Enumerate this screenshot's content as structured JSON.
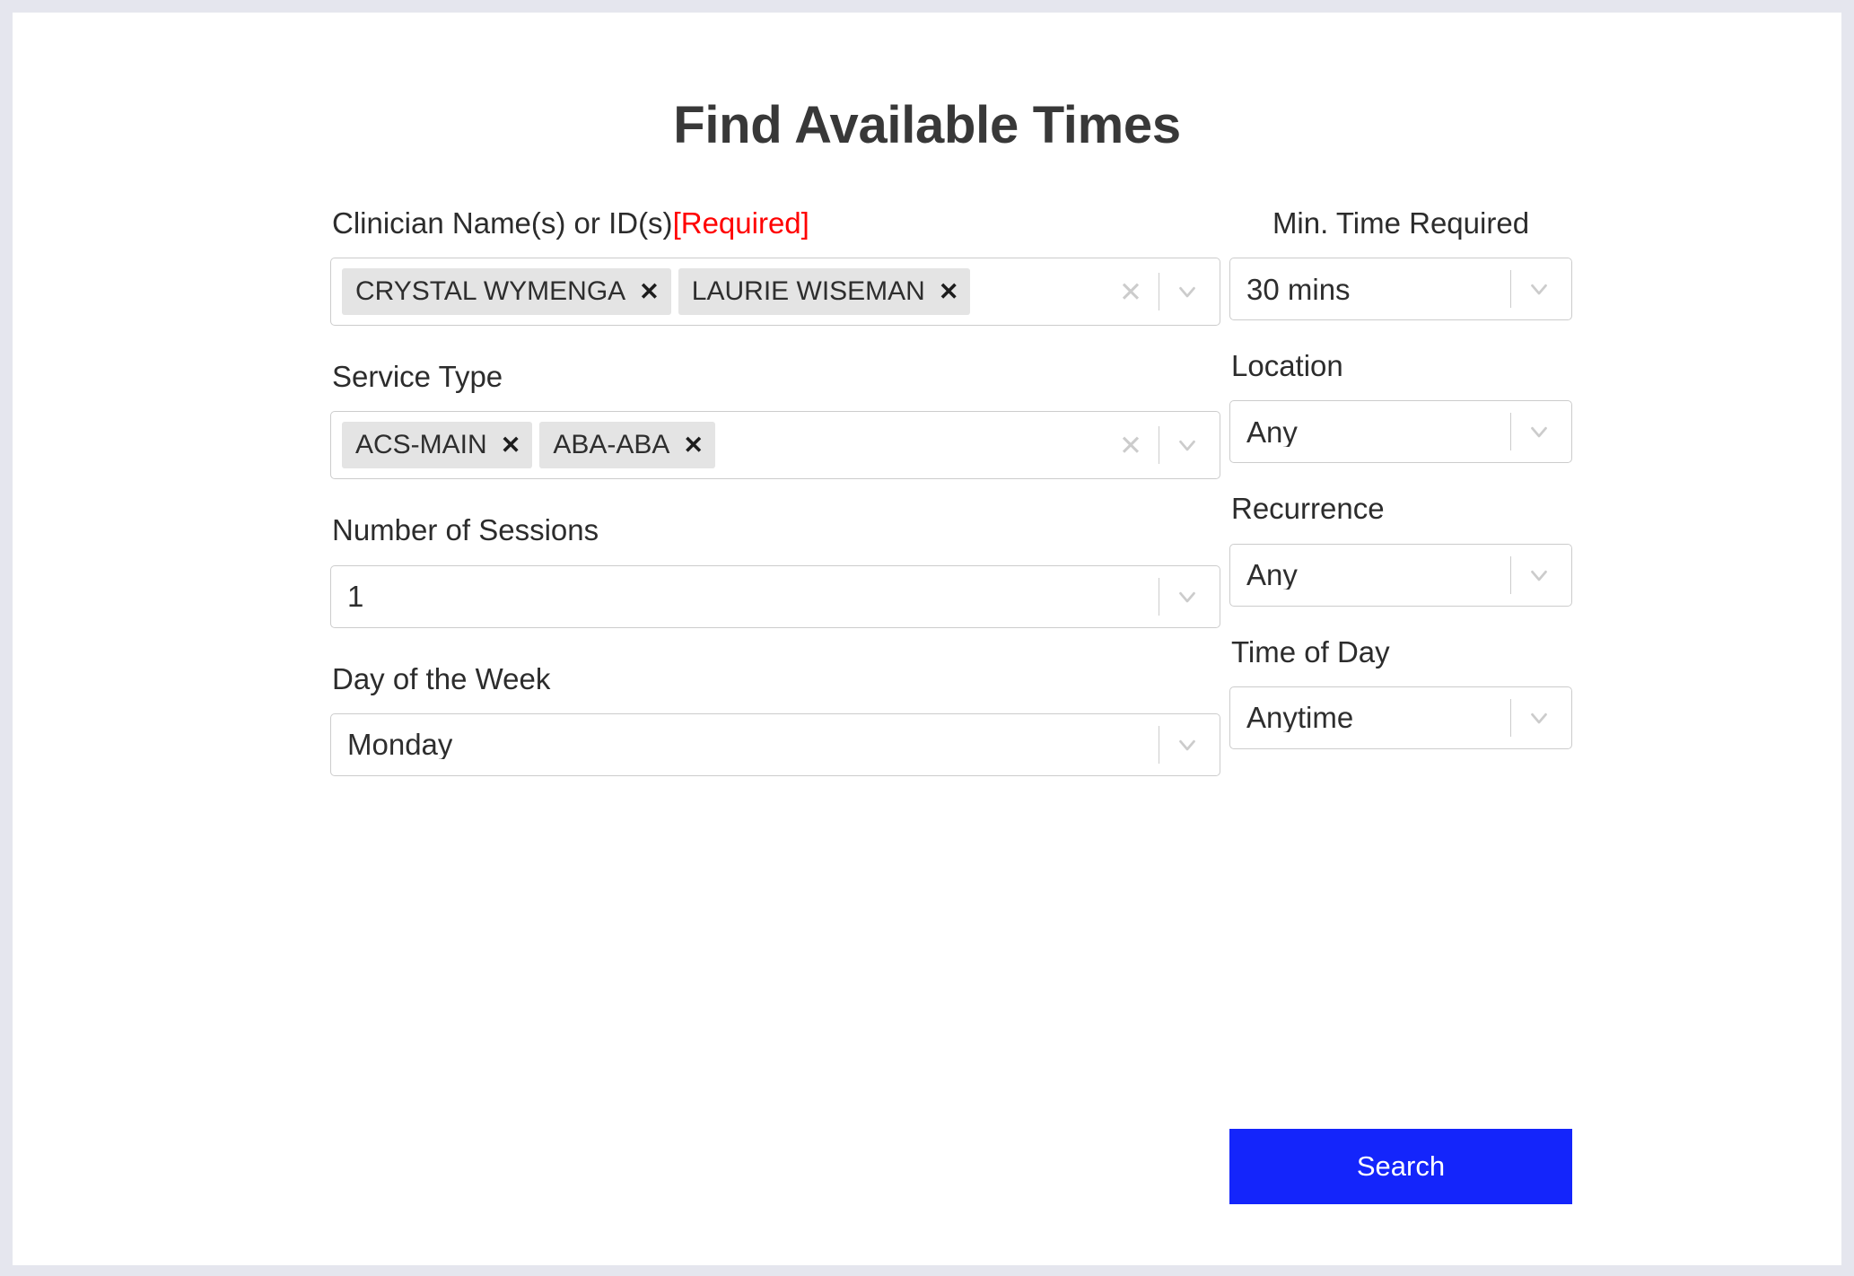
{
  "page": {
    "title": "Find Available Times",
    "accent_color": "#1425fb",
    "required_color": "#ff0000",
    "background_color": "#e5e6ee",
    "card_color": "#ffffff"
  },
  "left_column": {
    "clinician": {
      "label": "Clinician Name(s) or ID(s)",
      "required_text": "[Required]",
      "type": "multiselect",
      "tags": [
        {
          "label": "CRYSTAL WYMENGA",
          "remove_icon": "times-icon"
        },
        {
          "label": "LAURIE WISEMAN",
          "remove_icon": "times-icon"
        }
      ],
      "clear_icon": "clear-all-icon",
      "dropdown_icon": "chevron-down-icon"
    },
    "service_type": {
      "label": "Service Type",
      "type": "multiselect",
      "tags": [
        {
          "label": "ACS-MAIN",
          "remove_icon": "times-icon"
        },
        {
          "label": "ABA-ABA",
          "remove_icon": "times-icon"
        }
      ],
      "clear_icon": "clear-all-icon",
      "dropdown_icon": "chevron-down-icon"
    },
    "number_of_sessions": {
      "label": "Number of Sessions",
      "type": "select",
      "value": "1",
      "dropdown_icon": "chevron-down-icon"
    },
    "day_of_week": {
      "label": "Day of the Week",
      "type": "select",
      "value": "Monday",
      "dropdown_icon": "chevron-down-icon"
    }
  },
  "right_column": {
    "min_time_required": {
      "label": "Min. Time Required",
      "type": "select",
      "value": "30 mins",
      "dropdown_icon": "chevron-down-icon"
    },
    "location": {
      "label": "Location",
      "type": "select",
      "value": "Any",
      "dropdown_icon": "chevron-down-icon"
    },
    "recurrence": {
      "label": "Recurrence",
      "type": "select",
      "value": "Any",
      "dropdown_icon": "chevron-down-icon"
    },
    "time_of_day": {
      "label": "Time of Day",
      "type": "select",
      "value": "Anytime",
      "dropdown_icon": "chevron-down-icon"
    }
  },
  "actions": {
    "search_label": "Search"
  }
}
